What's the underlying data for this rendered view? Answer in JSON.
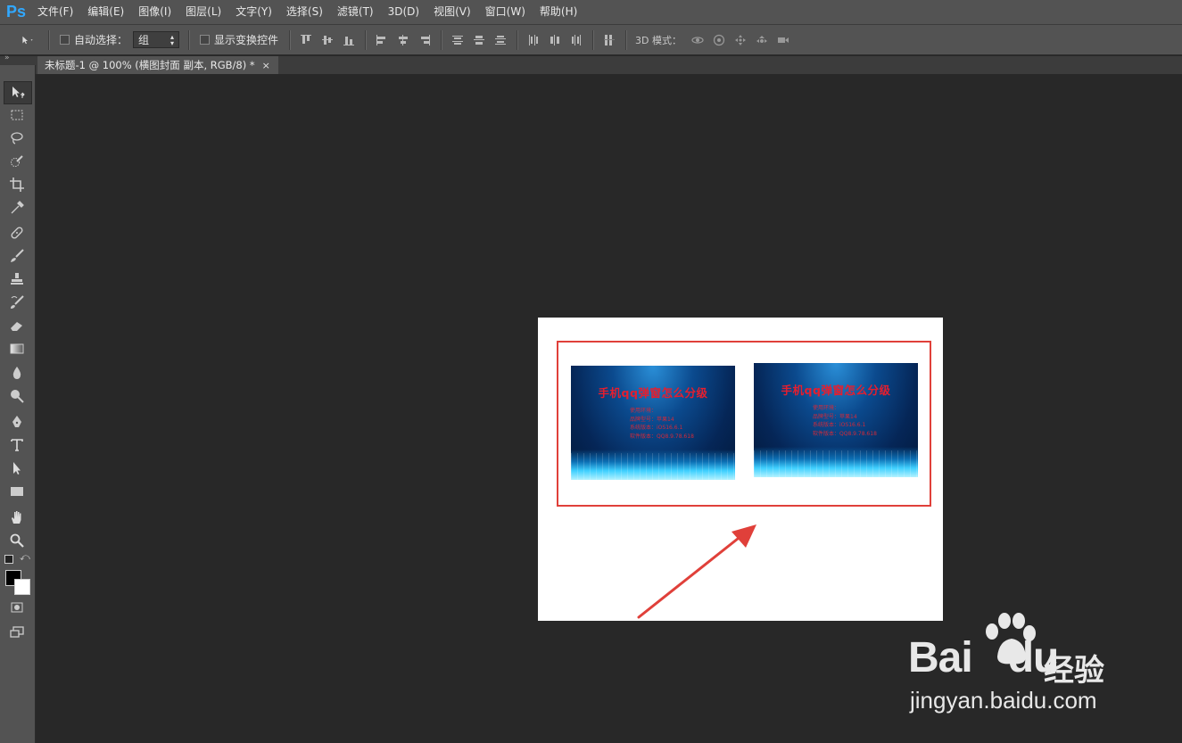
{
  "app": {
    "logo": "Ps"
  },
  "menu": [
    "文件(F)",
    "编辑(E)",
    "图像(I)",
    "图层(L)",
    "文字(Y)",
    "选择(S)",
    "滤镜(T)",
    "3D(D)",
    "视图(V)",
    "窗口(W)",
    "帮助(H)"
  ],
  "options": {
    "auto_select_label": "自动选择：",
    "auto_select_value": "组",
    "show_transform_label": "显示变换控件",
    "mode_3d_label": "3D 模式："
  },
  "document": {
    "tab_title": "未标题-1 @ 100% (横图封面 副本, RGB/8) *",
    "close": "×"
  },
  "covers": [
    {
      "title": "手机qq弹窗怎么分级",
      "lines": [
        "使用环境：",
        "品牌型号：苹果14",
        "系统版本：iOS16.6.1",
        "软件版本：QQ8.9.78.618"
      ]
    },
    {
      "title": "手机qq弹窗怎么分级",
      "lines": [
        "使用环境：",
        "品牌型号：苹果14",
        "系统版本：iOS16.6.1",
        "软件版本：QQ8.9.78.618"
      ]
    }
  ],
  "watermark": {
    "word": "Bai",
    "word2": "du",
    "cn": "经验",
    "url": "jingyan.baidu.com"
  },
  "colors": {
    "highlight": "#e0403a",
    "arrow": "#e0403a",
    "ps_blue": "#31a8ff"
  }
}
